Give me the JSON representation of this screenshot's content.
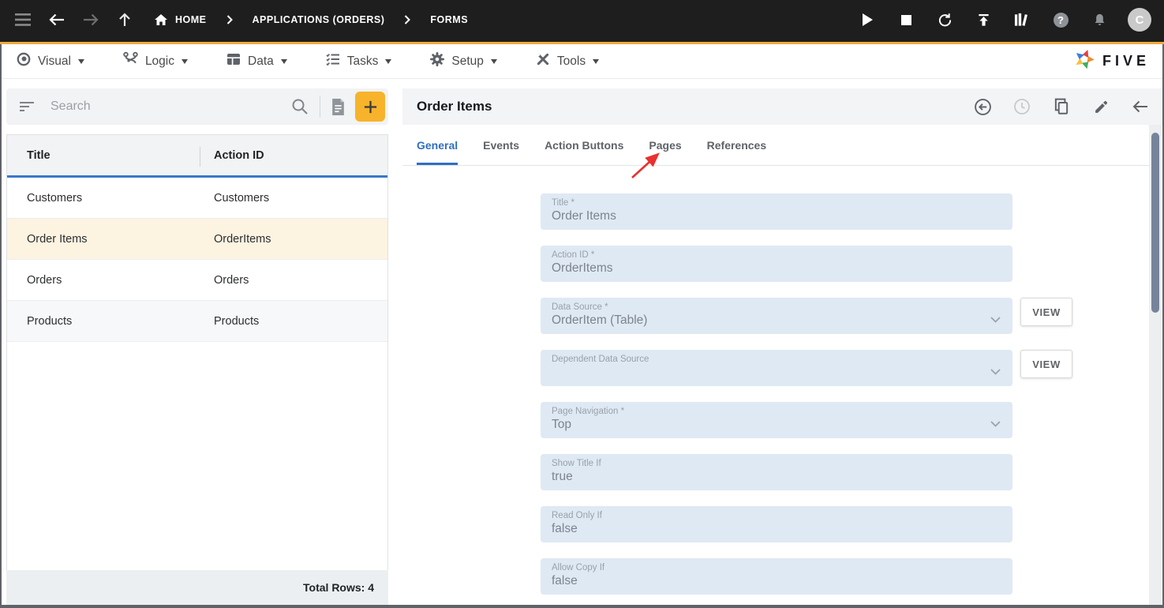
{
  "topbar": {
    "left_icons": [
      {
        "name": "menu"
      },
      {
        "name": "back"
      },
      {
        "name": "forward"
      },
      {
        "name": "up"
      }
    ],
    "breadcrumbs": [
      "HOME",
      "APPLICATIONS (ORDERS)",
      "FORMS"
    ],
    "right_icons": [
      {
        "name": "run"
      },
      {
        "name": "stop"
      },
      {
        "name": "restart"
      },
      {
        "name": "deploy"
      },
      {
        "name": "library"
      },
      {
        "name": "help"
      },
      {
        "name": "notifications"
      }
    ],
    "avatar_initial": "C"
  },
  "menubar": {
    "items": [
      {
        "label": "Visual",
        "icon": "visual"
      },
      {
        "label": "Logic",
        "icon": "logic"
      },
      {
        "label": "Data",
        "icon": "data"
      },
      {
        "label": "Tasks",
        "icon": "tasks"
      },
      {
        "label": "Setup",
        "icon": "setup"
      },
      {
        "label": "Tools",
        "icon": "tools"
      }
    ],
    "brand": "FIVE"
  },
  "left_panel": {
    "search_placeholder": "Search",
    "table": {
      "columns": [
        "Title",
        "Action ID"
      ],
      "rows": [
        {
          "title": "Customers",
          "action_id": "Customers",
          "selected": false
        },
        {
          "title": "Order Items",
          "action_id": "OrderItems",
          "selected": true
        },
        {
          "title": "Orders",
          "action_id": "Orders",
          "selected": false
        },
        {
          "title": "Products",
          "action_id": "Products",
          "selected": false
        }
      ]
    },
    "footer_label": "Total Rows: 4"
  },
  "right_panel": {
    "title": "Order Items",
    "header_icons": [
      "return",
      "history",
      "copy",
      "edit",
      "collapse"
    ],
    "tabs": [
      {
        "label": "General",
        "active": true
      },
      {
        "label": "Events",
        "active": false
      },
      {
        "label": "Action Buttons",
        "active": false
      },
      {
        "label": "Pages",
        "active": false
      },
      {
        "label": "References",
        "active": false
      }
    ],
    "view_button_label": "VIEW",
    "fields": [
      {
        "label": "Title *",
        "value": "Order Items",
        "dropdown": false,
        "view_button": false
      },
      {
        "label": "Action ID *",
        "value": "OrderItems",
        "dropdown": false,
        "view_button": false
      },
      {
        "label": "Data Source *",
        "value": "OrderItem (Table)",
        "dropdown": true,
        "view_button": true
      },
      {
        "label": "Dependent Data Source",
        "value": "",
        "dropdown": true,
        "view_button": true
      },
      {
        "label": "Page Navigation *",
        "value": "Top",
        "dropdown": true,
        "view_button": false
      },
      {
        "label": "Show Title If",
        "value": "true",
        "dropdown": false,
        "view_button": false
      },
      {
        "label": "Read Only If",
        "value": "false",
        "dropdown": false,
        "view_button": false
      },
      {
        "label": "Allow Copy If",
        "value": "false",
        "dropdown": false,
        "view_button": false
      }
    ]
  },
  "annotation": {
    "type": "arrow",
    "color": "#e8312f",
    "points_to": "Pages tab"
  },
  "colors": {
    "topbar_bg": "#1e1e1e",
    "accent_yellow": "#efa93b",
    "add_button": "#f7b32b",
    "selected_row": "#fdf3e1",
    "table_header_rule": "#3b78c8",
    "active_tab": "#2e6fc2",
    "field_bg": "#dfe9f4",
    "scrollbar_thumb": "#76849b",
    "annotation_red": "#e8312f"
  }
}
